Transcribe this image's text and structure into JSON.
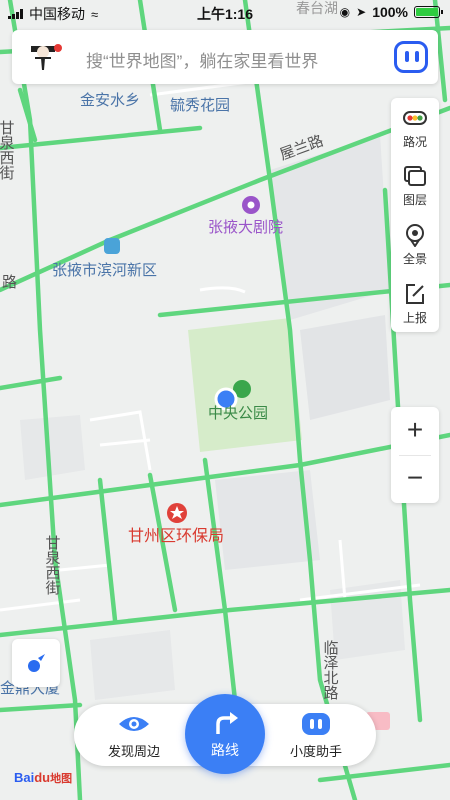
{
  "status_bar": {
    "carrier": "中国移动",
    "time": "上午1:16",
    "battery": "100%",
    "battery_level": 1.0
  },
  "search": {
    "placeholder": "搜“世界地图”，躺在家里看世界"
  },
  "map_labels": {
    "jinan_shuixiang": "金安水乡",
    "yuxiu_huayuan": "毓秀花园",
    "ganquan_xijie_top": "甘泉西街",
    "wulan_road": "屋兰路",
    "grand_theatre": "张掖大剧院",
    "binhe_district": "张掖市滨河新区",
    "road_fragment_left": "路",
    "central_park": "中央公园",
    "env_bureau": "甘州区环保局",
    "ganquan_xijie_bottom": "甘泉西街",
    "linze_north_road": "临泽北路",
    "jinding_building": "金鼎大厦",
    "top_cut_label": "春台湖"
  },
  "tools": {
    "traffic": "路况",
    "layers": "图层",
    "panorama": "全景",
    "report": "上报"
  },
  "zoom": {
    "in": "+",
    "out": "−"
  },
  "bottom_bar": {
    "discover": "发现周边",
    "route": "路线",
    "assistant": "小度助手"
  },
  "logo": {
    "bai": "Bai",
    "du": "du",
    "map": "地图"
  },
  "colors": {
    "road": "#5fd67e",
    "accent": "#2a5cf0",
    "route_button": "#3b7ff5",
    "park": "#d6ecca",
    "poi_red": "#e0413a",
    "poi_purple": "#9a55c9",
    "poi_green": "#3aa64c"
  }
}
